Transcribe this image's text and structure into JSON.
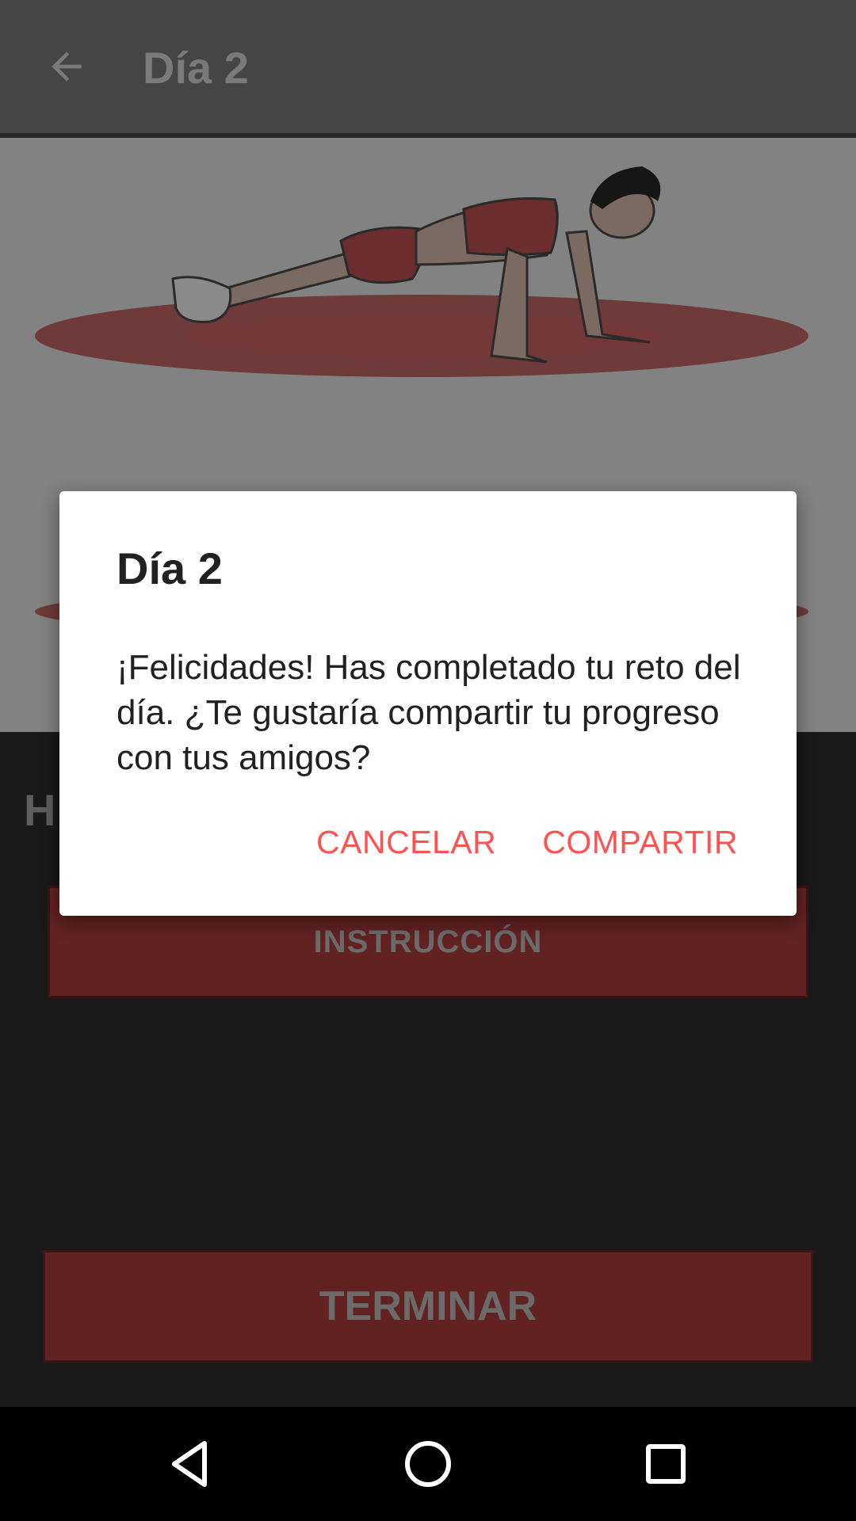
{
  "app_bar": {
    "title": "Día 2",
    "back_icon": "arrow-left-icon"
  },
  "exercise": {
    "name_partial": "H"
  },
  "buttons": {
    "instruction_label": "INSTRUCCIÓN",
    "finish_label": "TERMINAR"
  },
  "dialog": {
    "title": "Día 2",
    "message": "¡Felicidades! Has completado tu reto del día. ¿Te gustaría compartir tu progreso con tus amigos?",
    "cancel_label": "CANCELAR",
    "share_label": "COMPARTIR"
  },
  "nav_bar": {
    "back_icon": "triangle-back-icon",
    "home_icon": "circle-home-icon",
    "recents_icon": "square-recents-icon"
  },
  "colors": {
    "accent": "#ff5252",
    "button_dimmed": "#632222",
    "scrim_bg": "#191919"
  }
}
